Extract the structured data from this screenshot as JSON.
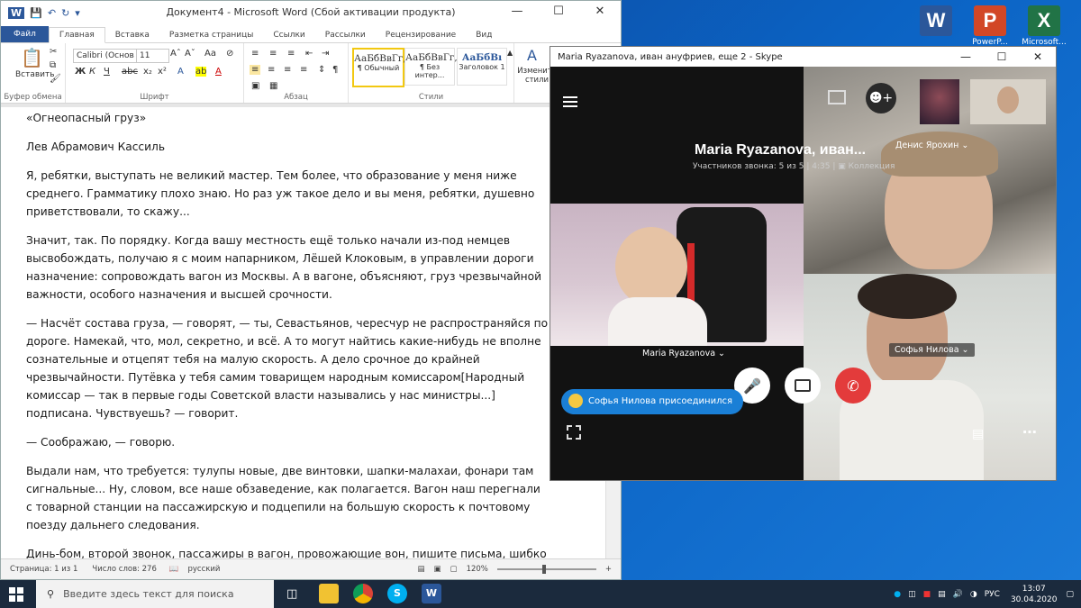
{
  "desktop": {
    "icons": [
      {
        "label": "",
        "letter": "W",
        "color": "#2b579a"
      },
      {
        "label": "PowerP...",
        "letter": "P",
        "color": "#d24726"
      },
      {
        "label": "Microsoft...",
        "letter": "X",
        "color": "#217346"
      }
    ]
  },
  "word": {
    "title": "Документ4 - Microsoft Word (Сбой активации продукта)",
    "tabs": [
      "Файл",
      "Главная",
      "Вставка",
      "Разметка страницы",
      "Ссылки",
      "Рассылки",
      "Рецензирование",
      "Вид"
    ],
    "ribbon": {
      "paste_label": "Вставить",
      "clipboard_label": "Буфер обмена",
      "font_name": "Calibri (Основ",
      "font_size": "11",
      "font_label": "Шрифт",
      "paragraph_label": "Абзац",
      "styles_label": "Стили",
      "styles": [
        {
          "sample": "АаБбВвГг,",
          "name": "¶ Обычный"
        },
        {
          "sample": "АаБбВвГг,",
          "name": "¶ Без интер..."
        },
        {
          "sample": "АаБбВı",
          "name": "Заголовок 1"
        }
      ],
      "change_styles_label": "Изменить стили"
    },
    "paragraphs": [
      "«Огнеопасный груз»",
      "Лев Абрамович Кассиль",
      "Я, ребятки, выступать не великий мастер. Тем более, что образование у меня ниже среднего. Грамматику плохо знаю. Но раз уж такое дело и вы меня, ребятки, душевно приветствовали, то скажу...",
      "Значит, так. По порядку. Когда вашу местность ещё только начали из-под немцев высвобождать, получаю я с моим напарником, Лёшей Клоковым, в управлении дороги назначение: сопровождать вагон из Москвы. А в вагоне, объясняют, груз чрезвычайной важности, особого назначения и высшей срочности.",
      "— Насчёт состава груза, — говорят, — ты, Севастьянов, чересчур не распространяйся по дороге. Намекай, что, мол, секретно, и всё. А то могут найтись какие-нибудь не вполне сознательные и отцепят тебя на малую скорость. А дело срочное до крайней чрезвычайности. Путёвка у тебя самим товарищем народным комиссаром[Народный комиссар — так в первые годы Советской власти назывались у нас министры...] подписана. Чувствуешь? — говорит.",
      "— Соображаю, — говорю.",
      "Выдали нам, что требуется: тулупы новые, две винтовки, шапки-малахаи, фонари там сигнальные... Ну, словом, все наше обзаведение, как полагается. Вагон наш перегнали с товарной станции на пассажирскую и подцепили на большую скорость к почтовому поезду дальнего следования.",
      "Динь-бом, второй звонок, пассажиры в вагон, провожающие вон, пишите письма, шибко не скучайте, совсем не забывайте, поехали!"
    ],
    "status": {
      "page": "Страница: 1 из 1",
      "words": "Число слов: 276",
      "language": "русский",
      "zoom": "120%"
    }
  },
  "skype": {
    "title": "Maria Ryazanova, иван ануфриев, еще 2 - Skype",
    "call_title": "Maria Ryazanova, иван...",
    "participants": "Участников звонка: 5 из 5",
    "duration": "4:35",
    "collection": "Коллекция",
    "tiles": [
      {
        "name": "Maria Ryazanova"
      },
      {
        "name": "Денис Ярохин"
      },
      {
        "name": "Софья Нилова"
      }
    ],
    "notification": "Софья Нилова присоединился"
  },
  "taskbar": {
    "search_placeholder": "Введите здесь текст для поиска",
    "lang": "РУС",
    "time": "13:07",
    "date": "30.04.2020"
  }
}
